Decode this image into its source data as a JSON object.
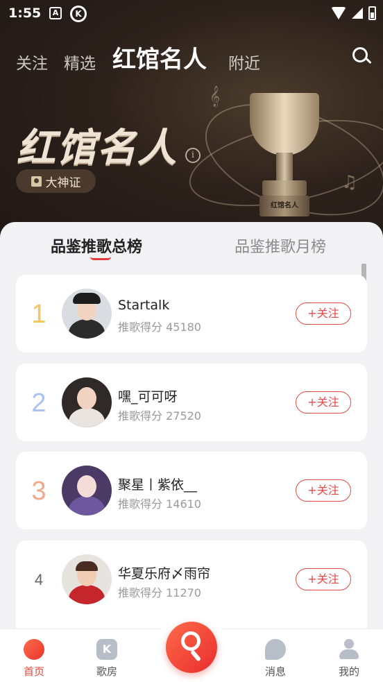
{
  "status_bar": {
    "time": "1:55",
    "icon_a": "A",
    "icon_k": "K"
  },
  "top_nav": {
    "tabs": [
      "关注",
      "精选",
      "红馆名人",
      "附近"
    ],
    "active_index": 2
  },
  "hero": {
    "title": "红馆名人",
    "info_icon": "i",
    "badge_label": "大神证",
    "trophy_plaque": "红馆名人"
  },
  "panel": {
    "tabs": [
      "品鉴推歌总榜",
      "品鉴推歌月榜"
    ],
    "active_index": 0
  },
  "ranking": [
    {
      "rank": "1",
      "name": "Startalk",
      "score": "推歌得分 45180",
      "follow": "+关注",
      "rank_color": "#f5c45a"
    },
    {
      "rank": "2",
      "name": "嘿_可可呀",
      "score": "推歌得分 27520",
      "follow": "+关注",
      "rank_color": "#a9c3f0"
    },
    {
      "rank": "3",
      "name": "聚星丨紫依__",
      "score": "推歌得分 14610",
      "follow": "+关注",
      "rank_color": "#f0a98a"
    },
    {
      "rank": "4",
      "name": "华夏乐府〆雨帘",
      "score": "推歌得分 11270",
      "follow": "+关注",
      "rank_color": "#666666"
    }
  ],
  "bottom_nav": {
    "items": [
      {
        "label": "首页",
        "icon": "planet-icon"
      },
      {
        "label": "歌房",
        "icon": "k-room-icon"
      },
      {
        "label": "消息",
        "icon": "message-icon"
      },
      {
        "label": "我的",
        "icon": "profile-icon"
      }
    ],
    "active_index": 0
  },
  "colors": {
    "accent": "#e8483a",
    "hero_bg": "#2c211b"
  }
}
